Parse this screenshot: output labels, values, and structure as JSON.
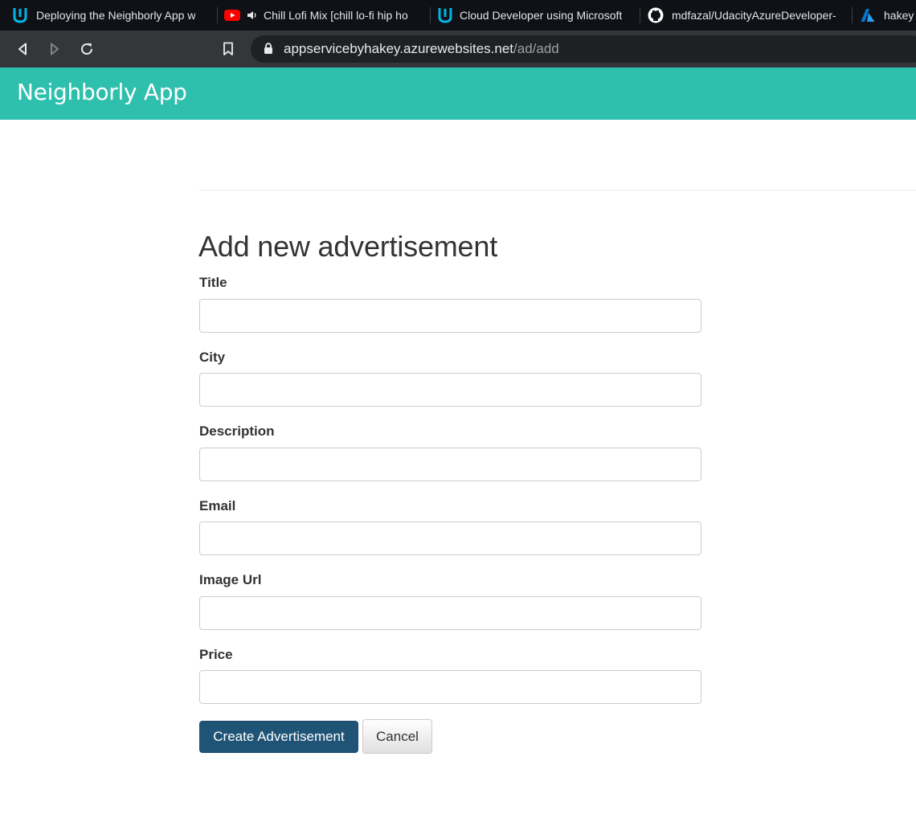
{
  "browser": {
    "tabs": [
      {
        "title": "Deploying the Neighborly App w",
        "icon": "udacity-icon"
      },
      {
        "title": "Chill Lofi Mix [chill lo-fi hip ho",
        "icon": "youtube-icon",
        "audio_icon": "speaker-icon"
      },
      {
        "title": "Cloud Developer using Microsoft",
        "icon": "udacity-icon"
      },
      {
        "title": "mdfazal/UdacityAzureDeveloper-",
        "icon": "github-icon"
      },
      {
        "title": "hakey",
        "icon": "azure-icon"
      }
    ],
    "url_host": "appservicebyhakey.azurewebsites.net",
    "url_path": "/ad/add"
  },
  "app": {
    "brand": "Neighborly App"
  },
  "form": {
    "title": "Add new advertisement",
    "fields": [
      {
        "label": "Title",
        "value": ""
      },
      {
        "label": "City",
        "value": ""
      },
      {
        "label": "Description",
        "value": ""
      },
      {
        "label": "Email",
        "value": ""
      },
      {
        "label": "Image Url",
        "value": ""
      },
      {
        "label": "Price",
        "value": ""
      }
    ],
    "submit_label": "Create Advertisement",
    "cancel_label": "Cancel"
  },
  "colors": {
    "header": "#2fbfad",
    "primary_button": "#1f5477",
    "udacity_icon": "#02b3e4",
    "youtube_icon": "#ff0000",
    "azure_icon": "#0089d6"
  }
}
